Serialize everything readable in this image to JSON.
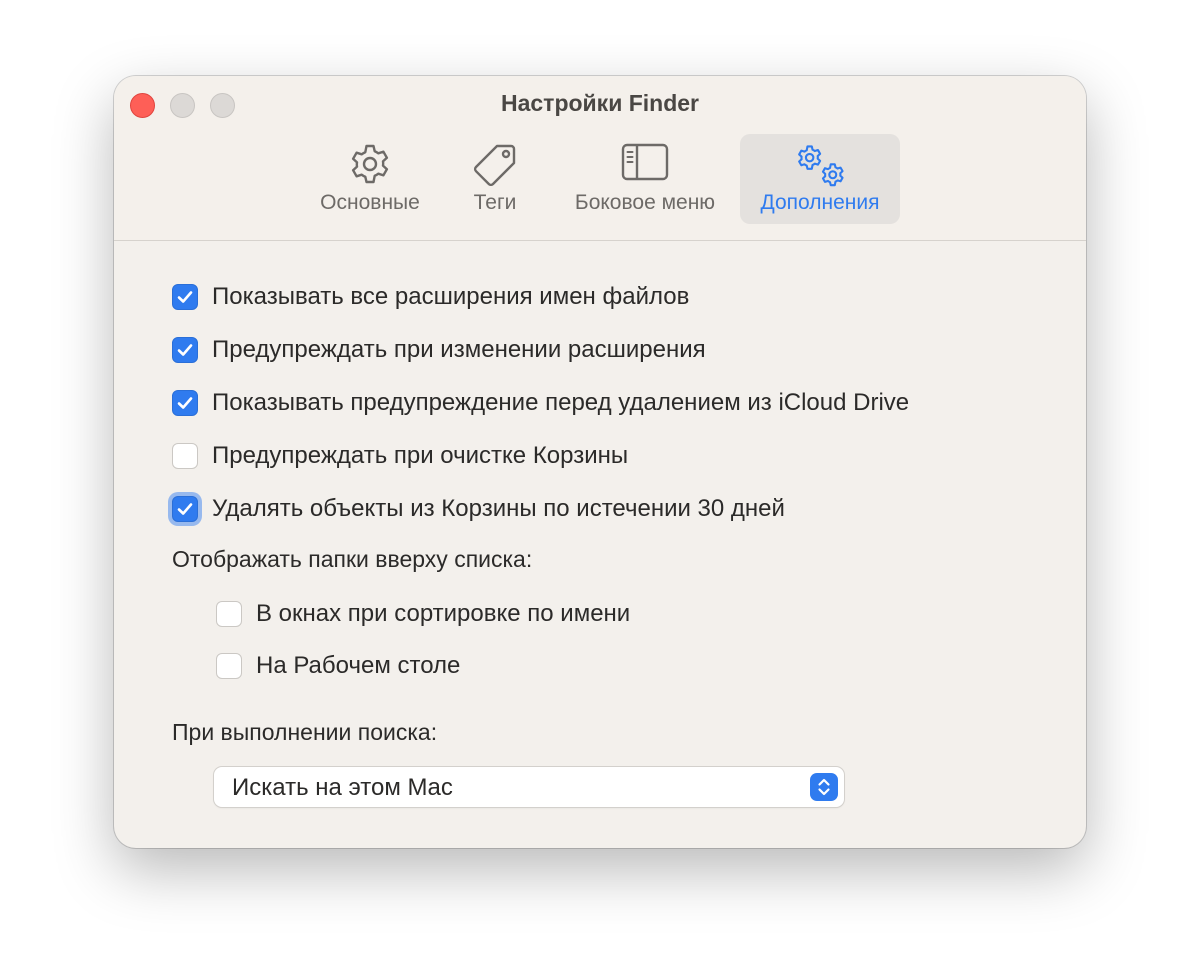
{
  "window": {
    "title": "Настройки Finder"
  },
  "tabs": [
    {
      "label": "Основные",
      "icon": "gear-icon",
      "active": false
    },
    {
      "label": "Теги",
      "icon": "tag-icon",
      "active": false
    },
    {
      "label": "Боковое меню",
      "icon": "sidebar-icon",
      "active": false
    },
    {
      "label": "Дополнения",
      "icon": "gears-icon",
      "active": true
    }
  ],
  "options": [
    {
      "label": "Показывать все расширения имен файлов",
      "checked": true
    },
    {
      "label": "Предупреждать при изменении расширения",
      "checked": true
    },
    {
      "label": "Показывать предупреждение перед удалением из iCloud Drive",
      "checked": true
    },
    {
      "label": "Предупреждать при очистке Корзины",
      "checked": false
    },
    {
      "label": "Удалять объекты из Корзины по истечении 30 дней",
      "checked": true
    }
  ],
  "folders_section": {
    "label": "Отображать папки вверху списка:",
    "options": [
      {
        "label": "В окнах при сортировке по имени",
        "checked": false
      },
      {
        "label": "На Рабочем столе",
        "checked": false
      }
    ]
  },
  "search_section": {
    "label": "При выполнении поиска:",
    "selected": "Искать на этом Mac"
  },
  "colors": {
    "accent": "#2f7bef",
    "close_button": "#fe5f57",
    "window_bg": "#f3f0ec"
  }
}
